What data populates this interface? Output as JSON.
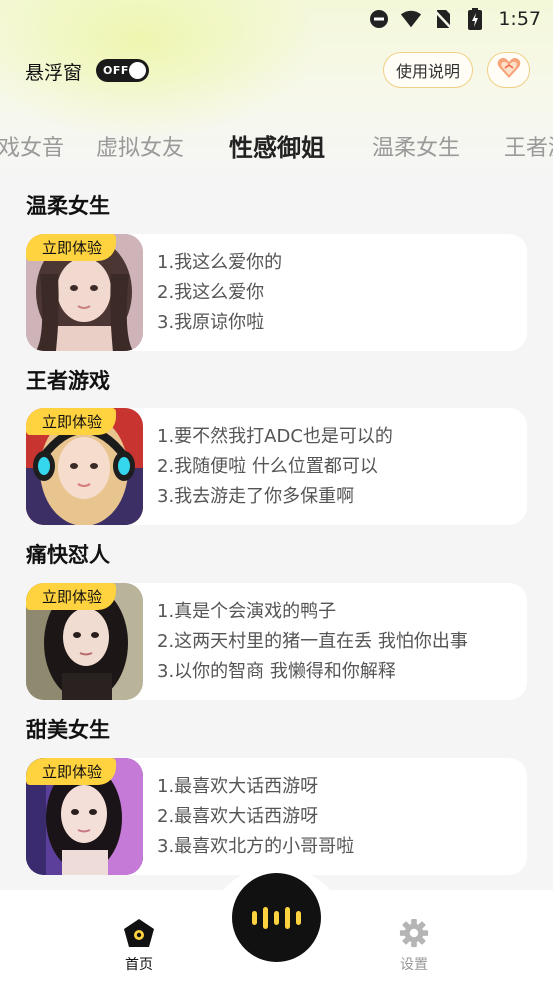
{
  "status_bar": {
    "time": "1:57"
  },
  "header": {
    "float_window_label": "悬浮窗",
    "toggle_state": "OFF",
    "help_label": "使用说明"
  },
  "tabs": [
    {
      "label": "戏女音",
      "active": false
    },
    {
      "label": "虚拟女友",
      "active": false
    },
    {
      "label": "性感御姐",
      "active": true
    },
    {
      "label": "温柔女生",
      "active": false
    },
    {
      "label": "王者游",
      "active": false
    }
  ],
  "sections": [
    {
      "title": "温柔女生",
      "badge": "立即体验",
      "lines": [
        "1.我这么爱你的",
        "2.我这么爱你",
        "3.我原谅你啦"
      ]
    },
    {
      "title": "王者游戏",
      "badge": "立即体验",
      "lines": [
        "1.要不然我打ADC也是可以的",
        "2.我随便啦 什么位置都可以",
        "3.我去游走了你多保重啊"
      ]
    },
    {
      "title": "痛快怼人",
      "badge": "立即体验",
      "lines": [
        "1.真是个会演戏的鸭子",
        "2.这两天村里的猪一直在丢 我怕你出事",
        "3.以你的智商 我懒得和你解释"
      ]
    },
    {
      "title": "甜美女生",
      "badge": "立即体验",
      "lines": [
        "1.最喜欢大话西游呀",
        "2.最喜欢大话西游呀",
        "3.最喜欢北方的小哥哥啦"
      ]
    }
  ],
  "bottom_nav": {
    "home_label": "首页",
    "settings_label": "设置"
  },
  "colors": {
    "accent_yellow": "#ffd23f",
    "active_text": "#222222",
    "inactive_text": "#9a9a9a"
  }
}
